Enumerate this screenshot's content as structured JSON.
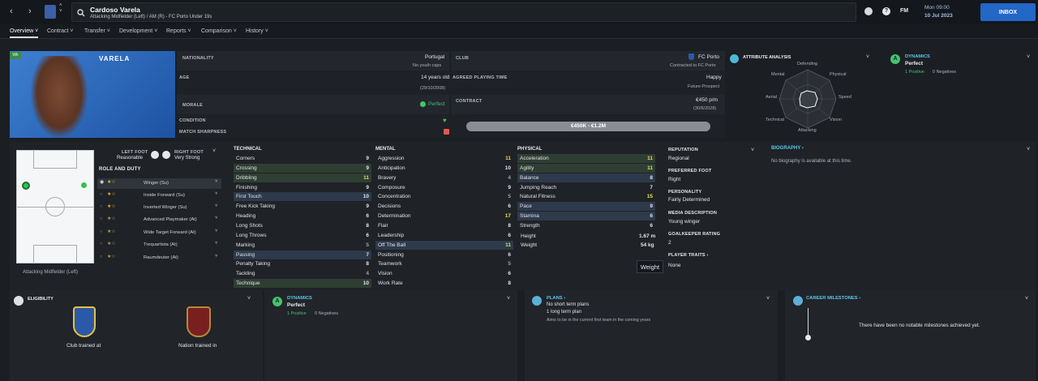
{
  "nav": {
    "back": "‹",
    "forward": "›"
  },
  "player": {
    "name": "Cardoso Varela",
    "subtitle": "Attacking Midfielder (Left) / AM (R) - FC Porto Under 19s",
    "short_name": "VARELA",
    "wonderkid_badge": "Wk"
  },
  "topbar": {
    "fm_label": "FM",
    "date_line1": "Mon 09:00",
    "date_line2": "10 Jul 2023",
    "inbox": "INBOX"
  },
  "tabs": [
    "Overview",
    "Contract",
    "Transfer",
    "Development",
    "Reports",
    "Comparison",
    "History"
  ],
  "info": {
    "nationality_label": "NATIONALITY",
    "nationality": "Portugal",
    "youth_caps": "No youth caps",
    "age_label": "AGE",
    "age": "14 years old",
    "dob": "(29/10/2008)",
    "morale_label": "MORALE",
    "morale": "Perfect",
    "condition_label": "CONDITION",
    "sharpness_label": "MATCH SHARPNESS",
    "club_label": "CLUB",
    "club": "FC Porto",
    "contracted": "Contracted to FC Porto",
    "apt_label": "AGREED PLAYING TIME",
    "apt": "Happy",
    "apt_sub": "Future Prospect",
    "contract_label": "CONTRACT",
    "wage": "€450 p/m",
    "contract_end": "(30/6/2028)",
    "value": "€450K - €1.2M"
  },
  "attr_analysis": {
    "title": "ATTRIBUTE ANALYSIS",
    "labels": [
      "Defending",
      "Physical",
      "Speed",
      "Vision",
      "Attacking",
      "Technical",
      "Aerial",
      "Mental"
    ]
  },
  "dynamics_top": {
    "title": "DYNAMICS",
    "value": "Perfect",
    "positives": "1 Positive",
    "negatives": "0 Negatives"
  },
  "feet": {
    "left_label": "LEFT FOOT",
    "left": "Reasonable",
    "right_label": "RIGHT FOOT",
    "right": "Very Strong"
  },
  "roles": {
    "title": "ROLE AND DUTY",
    "items": [
      "Winger (Su)",
      "Inside Forward (Su)",
      "Inverted Winger (Su)",
      "Advanced Playmaker (At)",
      "Wide Target Forward (At)",
      "Trequartista (At)",
      "Raumdeuter (At)"
    ],
    "position_caption": "Attacking Midfielder (Left)"
  },
  "technical": {
    "title": "TECHNICAL",
    "rows": [
      [
        "Corners",
        "9"
      ],
      [
        "Crossing",
        "9"
      ],
      [
        "Dribbling",
        "11"
      ],
      [
        "Finishing",
        "9"
      ],
      [
        "First Touch",
        "10"
      ],
      [
        "Free Kick Taking",
        "9"
      ],
      [
        "Heading",
        "6"
      ],
      [
        "Long Shots",
        "8"
      ],
      [
        "Long Throws",
        "6"
      ],
      [
        "Marking",
        "5"
      ],
      [
        "Passing",
        "7"
      ],
      [
        "Penalty Taking",
        "8"
      ],
      [
        "Tackling",
        "4"
      ],
      [
        "Technique",
        "10"
      ]
    ]
  },
  "mental": {
    "title": "MENTAL",
    "rows": [
      [
        "Aggression",
        "11"
      ],
      [
        "Anticipation",
        "10"
      ],
      [
        "Bravery",
        "4"
      ],
      [
        "Composure",
        "9"
      ],
      [
        "Concentration",
        "5"
      ],
      [
        "Decisions",
        "6"
      ],
      [
        "Determination",
        "17"
      ],
      [
        "Flair",
        "8"
      ],
      [
        "Leadership",
        "6"
      ],
      [
        "Off The Ball",
        "11"
      ],
      [
        "Positioning",
        "6"
      ],
      [
        "Teamwork",
        "5"
      ],
      [
        "Vision",
        "6"
      ],
      [
        "Work Rate",
        "8"
      ]
    ]
  },
  "physical": {
    "title": "PHYSICAL",
    "rows": [
      [
        "Acceleration",
        "11"
      ],
      [
        "Agility",
        "11"
      ],
      [
        "Balance",
        "8"
      ],
      [
        "Jumping Reach",
        "7"
      ],
      [
        "Natural Fitness",
        "15"
      ],
      [
        "Pace",
        "9"
      ],
      [
        "Stamina",
        "6"
      ],
      [
        "Strength",
        "6"
      ]
    ],
    "height_label": "Height",
    "height": "1.67 m",
    "weight_label": "Weight",
    "weight": "54 kg",
    "tooltip": "Weight"
  },
  "side": {
    "reputation_label": "REPUTATION",
    "reputation": "Regional",
    "pref_foot_label": "PREFERRED FOOT",
    "pref_foot": "Right",
    "personality_label": "PERSONALITY",
    "personality": "Fairly Determined",
    "media_label": "MEDIA DESCRIPTION",
    "media": "Young winger",
    "gk_label": "GOALKEEPER RATING",
    "gk": "2",
    "traits_label": "PLAYER TRAITS",
    "traits": "None"
  },
  "biography": {
    "title": "BIOGRAPHY",
    "text": "No biography is available at this time."
  },
  "eligibility": {
    "title": "ELIGIBILITY",
    "club": "Club trained at",
    "nation": "Nation trained in"
  },
  "dynamics_bottom": {
    "title": "DYNAMICS",
    "value": "Perfect",
    "positives": "1 Positive",
    "negatives": "0 Negatives"
  },
  "plans": {
    "title": "PLANS",
    "short": "No short term plans",
    "long": "1 long term plan",
    "long_sub": "Aims to be in the current first team in the coming years"
  },
  "milestones": {
    "title": "CAREER MILESTONES",
    "text": "There have been no notable milestones achieved yet."
  },
  "colors": {
    "accent": "#2367c7",
    "green": "#45c36f",
    "cyan": "#5bc8e8",
    "yellow": "#e8e44a"
  }
}
